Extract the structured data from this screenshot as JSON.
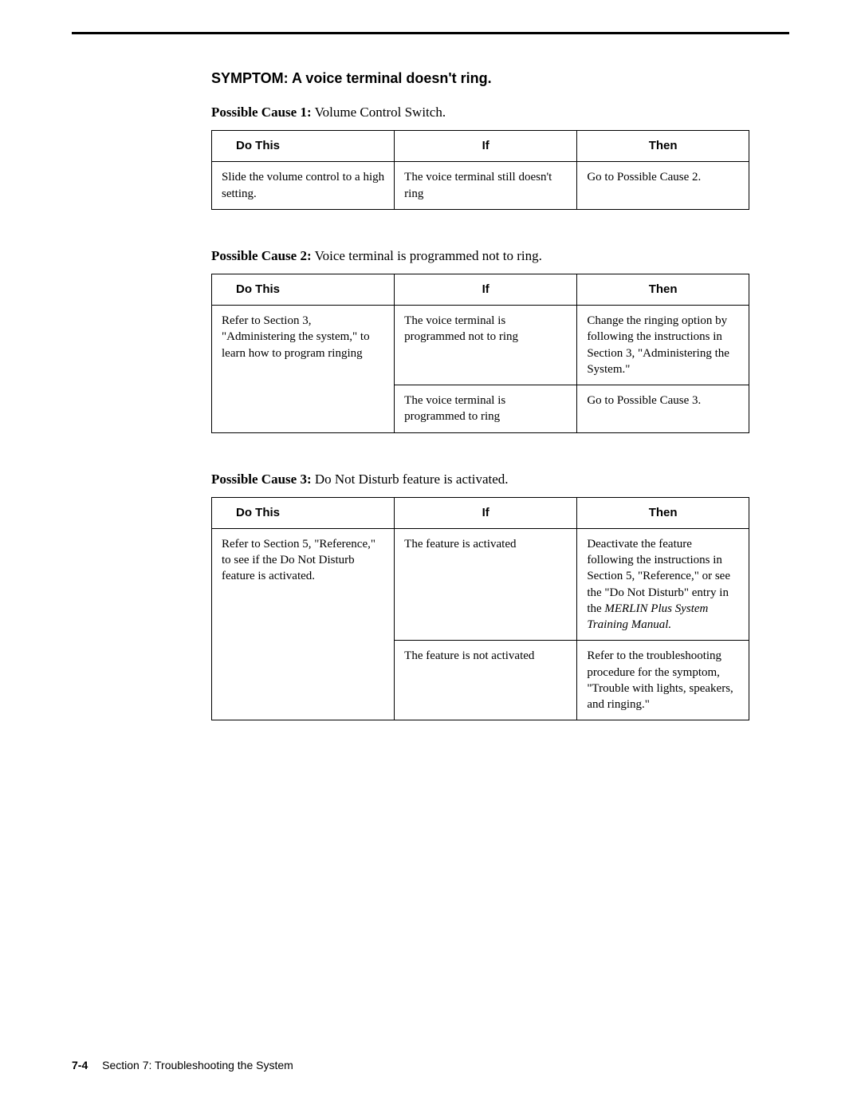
{
  "symptom_title": "SYMPTOM: A voice terminal doesn't ring.",
  "headers": {
    "do": "Do This",
    "if": "If",
    "then": "Then"
  },
  "cause1": {
    "label": "Possible Cause 1:",
    "text": " Volume Control Switch.",
    "rows": [
      {
        "do": "Slide the volume control to a high setting.",
        "if": "The voice terminal still doesn't ring",
        "then": "Go to Possible Cause 2."
      }
    ]
  },
  "cause2": {
    "label": "Possible Cause 2:",
    "text": " Voice terminal is programmed not to ring.",
    "rows": [
      {
        "do": "Refer to Section 3, \"Administering the system,\" to learn how to program ringing",
        "if": "The voice terminal is programmed not to ring",
        "then": "Change the ringing option by following the instructions in Section 3, \"Administering the System.\""
      },
      {
        "if": "The voice terminal is programmed to ring",
        "then": "Go to Possible Cause 3."
      }
    ]
  },
  "cause3": {
    "label": "Possible Cause 3:",
    "text": " Do Not Disturb feature is activated.",
    "rows": [
      {
        "do": "Refer to Section 5, \"Reference,\" to see if the Do Not Disturb feature is activated.",
        "if": "The feature is activated",
        "then_pre": "Deactivate the feature following the instructions in Section 5, \"Reference,\" or see the \"Do Not Disturb\" entry in the ",
        "then_italic": "MERLIN Plus System Training Manual.",
        "then_post": ""
      },
      {
        "if": "The feature is not activated",
        "then": "Refer to the troubleshooting procedure for the symptom, \"Trouble with lights, speakers, and ringing.\""
      }
    ]
  },
  "footer": {
    "page": "7-4",
    "section": "Section 7: Troubleshooting the System"
  }
}
